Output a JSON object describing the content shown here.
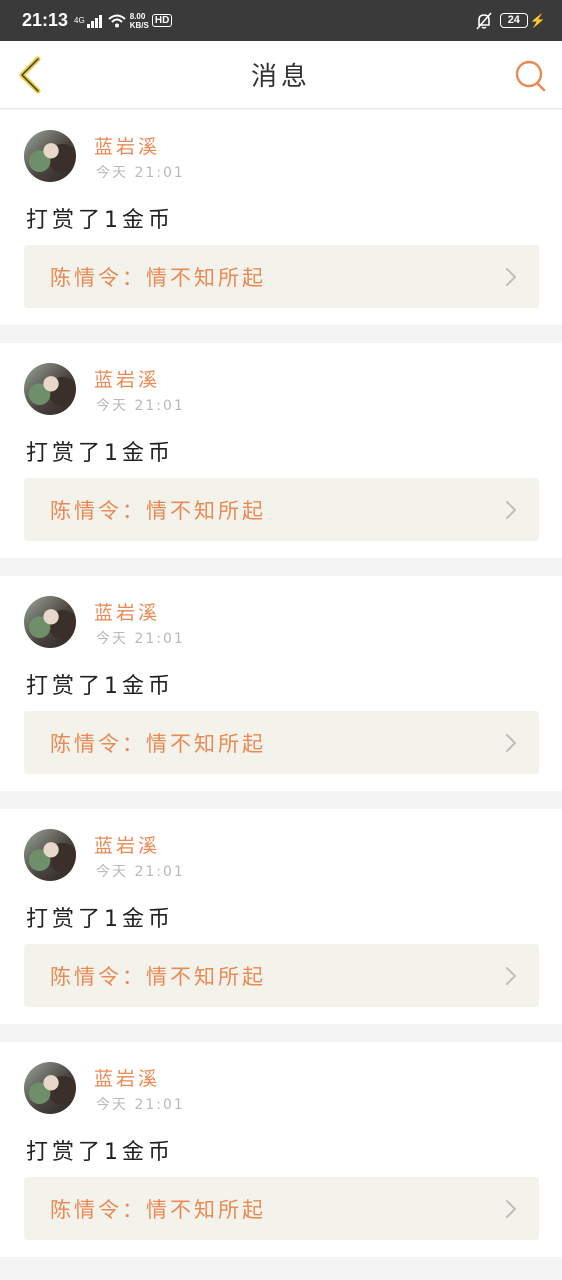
{
  "status_bar": {
    "time": "21:13",
    "network": "4G",
    "speed_value": "8.00",
    "speed_unit": "KB/S",
    "hd": "HD",
    "battery": "24"
  },
  "nav": {
    "title": "消息",
    "back_icon": "chevron-left-icon",
    "search_icon": "search-icon"
  },
  "colors": {
    "accent": "#e98a55",
    "back": "#e7c93a",
    "link_bg": "#f3f3ec"
  },
  "messages": [
    {
      "username": "蓝岩溪",
      "time": "今天 21:01",
      "text": "打赏了1金币",
      "link": "陈情令：情不知所起"
    },
    {
      "username": "蓝岩溪",
      "time": "今天 21:01",
      "text": "打赏了1金币",
      "link": "陈情令：情不知所起"
    },
    {
      "username": "蓝岩溪",
      "time": "今天 21:01",
      "text": "打赏了1金币",
      "link": "陈情令：情不知所起"
    },
    {
      "username": "蓝岩溪",
      "time": "今天 21:01",
      "text": "打赏了1金币",
      "link": "陈情令：情不知所起"
    },
    {
      "username": "蓝岩溪",
      "time": "今天 21:01",
      "text": "打赏了1金币",
      "link": "陈情令：情不知所起"
    }
  ]
}
